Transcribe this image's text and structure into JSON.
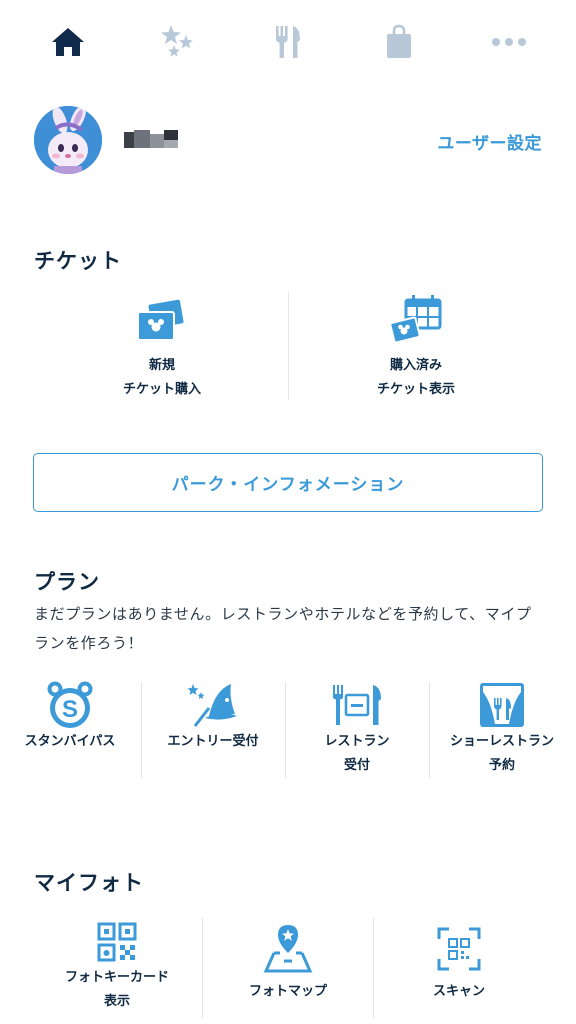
{
  "nav": {
    "items": [
      {
        "icon": "home-icon",
        "active": true
      },
      {
        "icon": "sparkle-stars-icon",
        "active": false
      },
      {
        "icon": "fork-knife-icon",
        "active": false
      },
      {
        "icon": "shopping-bag-icon",
        "active": false
      },
      {
        "icon": "more-dots-icon",
        "active": false
      }
    ]
  },
  "profile": {
    "avatar_icon": "bunny-character-avatar",
    "user_settings_label": "ユーザー設定"
  },
  "tickets": {
    "title": "チケット",
    "items": [
      {
        "icon": "new-ticket-icon",
        "line1": "新規",
        "line2": "チケット購入"
      },
      {
        "icon": "purchased-ticket-calendar-icon",
        "line1": "購入済み",
        "line2": "チケット表示"
      }
    ]
  },
  "park_info_button": "パーク・インフォメーション",
  "plan": {
    "title": "プラン",
    "description": "まだプランはありません。レストランやホテルなどを予約して、マイプランを作ろう！",
    "items": [
      {
        "icon": "standby-pass-icon",
        "line1": "スタンバイパス",
        "line2": ""
      },
      {
        "icon": "wizard-hat-icon",
        "line1": "エントリー受付",
        "line2": ""
      },
      {
        "icon": "restaurant-icon",
        "line1": "レストラン",
        "line2": "受付"
      },
      {
        "icon": "show-restaurant-icon",
        "line1": "ショーレストラン",
        "line2": "予約"
      }
    ]
  },
  "myphoto": {
    "title": "マイフォト",
    "items": [
      {
        "icon": "qr-code-icon",
        "line1": "フォトキーカード",
        "line2": "表示"
      },
      {
        "icon": "photo-map-icon",
        "line1": "フォトマップ",
        "line2": ""
      },
      {
        "icon": "scan-icon",
        "line1": "スキャン",
        "line2": ""
      }
    ]
  },
  "colors": {
    "accent": "#3a9ad9",
    "nav_active": "#0f2a4a",
    "nav_inactive": "#b9c8d8",
    "icon_blue": "#3d9ad8"
  }
}
